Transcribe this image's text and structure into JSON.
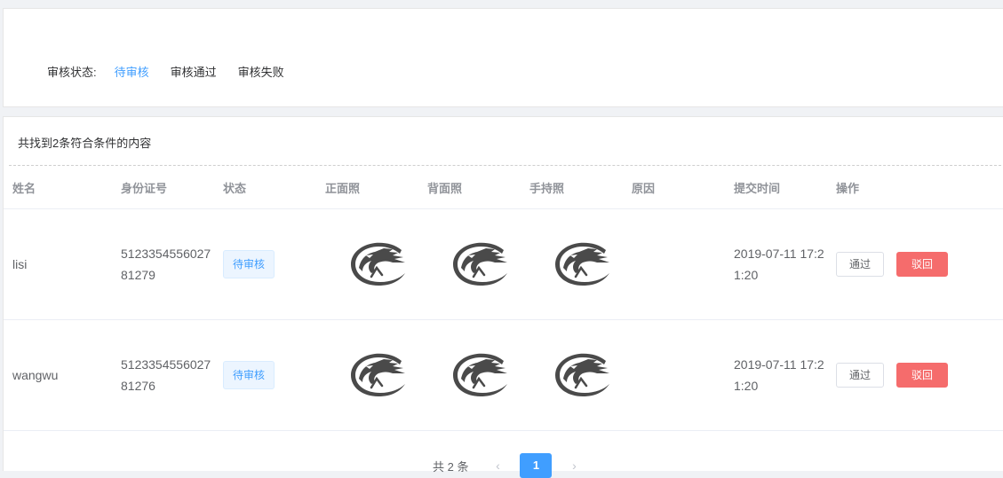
{
  "filter": {
    "label": "审核状态:",
    "options": [
      {
        "label": "待审核",
        "active": true
      },
      {
        "label": "审核通过",
        "active": false
      },
      {
        "label": "审核失败",
        "active": false
      }
    ]
  },
  "summary": "共找到2条符合条件的内容",
  "table": {
    "columns": [
      "姓名",
      "身份证号",
      "状态",
      "正面照",
      "背面照",
      "手持照",
      "原因",
      "提交时间",
      "操作"
    ],
    "rows": [
      {
        "name": "lisi",
        "id_number": "512335455602781279",
        "status": "待审核",
        "reason": "",
        "submit_time": "2019-07-11 17:21:20",
        "pass_label": "通过",
        "reject_label": "驳回"
      },
      {
        "name": "wangwu",
        "id_number": "512335455602781276",
        "status": "待审核",
        "reason": "",
        "submit_time": "2019-07-11 17:21:20",
        "pass_label": "通过",
        "reject_label": "驳回"
      }
    ]
  },
  "pagination": {
    "total_text": "共 2 条",
    "current_page": "1",
    "prev_icon": "chevron-left-icon",
    "next_icon": "chevron-right-icon"
  },
  "colors": {
    "accent": "#409eff",
    "danger": "#f56c6c"
  }
}
